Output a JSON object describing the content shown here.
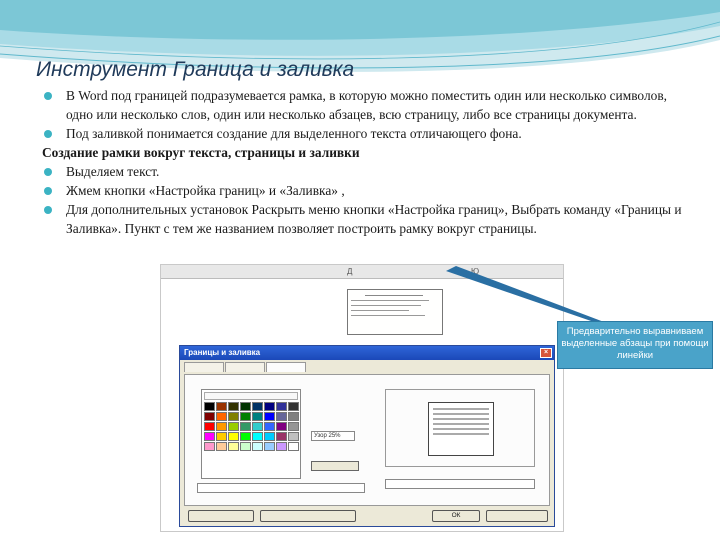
{
  "slide": {
    "title": "Инструмент Граница и заливка",
    "bullets": [
      "В Word под границей подразумевается рамка, в которую можно поместить один или несколько символов, одно или несколько слов, один или несколько абзацев, всю страницу, либо все страницы документа.",
      "Под заливкой понимается создание для выделенного текста отличающего фона."
    ],
    "heading": "Создание рамки вокруг текста, страницы и заливки",
    "steps": [
      "Выделяем текст.",
      "Жмем кнопки «Настройка границ» и «Заливка» ,",
      "Для дополнительных установок Раскрыть меню кнопки «Настройка границ», Выбрать команду «Границы и Заливка». Пункт с тем же названием позволяет построить рамку вокруг страницы."
    ]
  },
  "screenshot": {
    "ruler_marks": [
      "Д",
      "Ю"
    ],
    "dialog": {
      "title": "Границы и заливка",
      "pct_value": "Узор 25%",
      "ok_label": "ОК",
      "close_glyph": "×"
    },
    "swatch_colors": [
      "#000000",
      "#993300",
      "#333300",
      "#003300",
      "#003366",
      "#000080",
      "#333399",
      "#333333",
      "#800000",
      "#ff6600",
      "#808000",
      "#008000",
      "#008080",
      "#0000ff",
      "#666699",
      "#808080",
      "#ff0000",
      "#ff9900",
      "#99cc00",
      "#339966",
      "#33cccc",
      "#3366ff",
      "#800080",
      "#969696",
      "#ff00ff",
      "#ffcc00",
      "#ffff00",
      "#00ff00",
      "#00ffff",
      "#00ccff",
      "#993366",
      "#c0c0c0",
      "#ff99cc",
      "#ffcc99",
      "#ffff99",
      "#ccffcc",
      "#ccffff",
      "#99ccff",
      "#cc99ff",
      "#ffffff"
    ]
  },
  "callout": {
    "text": "Предварительно выравниваем выделенные абзацы при помощи линейки"
  },
  "colors": {
    "title": "#1f3a5a",
    "bullet": "#3bb3c3",
    "callout_bg": "#4aa3c9",
    "callout_border": "#2a7aa3",
    "arrow": "#2a6fa3"
  }
}
